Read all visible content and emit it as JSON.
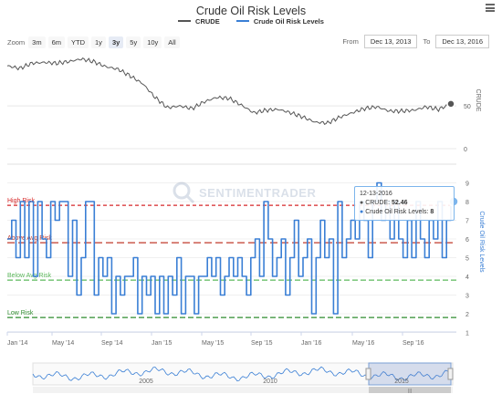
{
  "title": "Crude Oil Risk Levels",
  "legend": [
    {
      "name": "CRUDE",
      "color": "#555555"
    },
    {
      "name": "Crude Oil Risk Levels",
      "color": "#3a7fd5"
    }
  ],
  "zoom": {
    "label": "Zoom",
    "buttons": [
      "3m",
      "6m",
      "YTD",
      "1y",
      "3y",
      "5y",
      "10y",
      "All"
    ],
    "active": "3y"
  },
  "range": {
    "from_label": "From",
    "from": "Dec 13, 2013",
    "to_label": "To",
    "to": "Dec 13, 2016"
  },
  "watermark": "SENTIMENTRADER",
  "tooltip": {
    "date": "12-13-2016",
    "crude_label": "CRUDE:",
    "crude_value": "52.46",
    "risk_label": "Crude Oil Risk Levels:",
    "risk_value": "8"
  },
  "navigator_labels": [
    "2005",
    "2010",
    "2015"
  ],
  "colors": {
    "crude": "#555555",
    "risk": "#3a7fd5",
    "high": "#d62728",
    "above": "#c0392b",
    "below": "#5cb85c",
    "low": "#2e8b2e"
  },
  "chart_data": [
    {
      "type": "line",
      "name": "CRUDE",
      "ylabel": "CRUDE",
      "y_ticks": [
        0,
        50
      ],
      "ylim": [
        0,
        110
      ],
      "x": [
        "2013-12",
        "2014-01",
        "2014-02",
        "2014-03",
        "2014-04",
        "2014-05",
        "2014-06",
        "2014-07",
        "2014-08",
        "2014-09",
        "2014-10",
        "2014-11",
        "2014-12",
        "2015-01",
        "2015-02",
        "2015-03",
        "2015-04",
        "2015-05",
        "2015-06",
        "2015-07",
        "2015-08",
        "2015-09",
        "2015-10",
        "2015-11",
        "2015-12",
        "2016-01",
        "2016-02",
        "2016-03",
        "2016-04",
        "2016-05",
        "2016-06",
        "2016-07",
        "2016-08",
        "2016-09",
        "2016-10",
        "2016-11",
        "2016-12"
      ],
      "values": [
        97,
        94,
        100,
        101,
        100,
        102,
        105,
        102,
        96,
        93,
        85,
        76,
        60,
        48,
        50,
        47,
        55,
        60,
        59,
        51,
        42,
        45,
        46,
        42,
        37,
        31,
        30,
        37,
        42,
        47,
        49,
        44,
        44,
        45,
        49,
        46,
        52.46
      ]
    },
    {
      "type": "line",
      "name": "Crude Oil Risk Levels",
      "ylabel": "Crude Oil Risk Levels",
      "y_ticks": [
        1,
        2,
        3,
        4,
        5,
        6,
        7,
        8,
        9
      ],
      "ylim": [
        1,
        9.5
      ],
      "x_ticks": [
        "Jan '14",
        "May '14",
        "Sep '14",
        "Jan '15",
        "May '15",
        "Sep '15",
        "Jan '16",
        "May '16",
        "Sep '16"
      ],
      "reference_lines": [
        {
          "label": "High Risk",
          "value": 7.8
        },
        {
          "label": "Above Avg Risk",
          "value": 5.8
        },
        {
          "label": "Below Avg Risk",
          "value": 3.8
        },
        {
          "label": "Low Risk",
          "value": 1.8
        }
      ],
      "values": [
        6,
        7,
        5,
        8,
        5,
        8,
        4,
        8,
        6,
        5,
        8,
        7,
        8,
        8,
        4,
        7,
        3,
        5,
        8,
        8,
        3,
        5,
        4,
        5,
        2,
        4,
        3,
        4,
        4,
        5,
        2,
        4,
        3,
        4,
        2,
        4,
        2,
        4,
        3,
        5,
        2,
        4,
        4,
        2,
        4,
        4,
        5,
        4,
        5,
        3,
        4,
        5,
        4,
        5,
        4,
        3,
        5,
        6,
        4,
        8,
        6,
        4,
        5,
        6,
        3,
        5,
        7,
        4,
        5,
        6,
        2,
        5,
        7,
        5,
        6,
        2,
        8,
        5,
        6,
        7,
        6,
        8,
        7,
        5,
        8,
        9,
        7,
        8,
        6,
        8,
        6,
        5,
        7,
        5,
        8,
        6,
        5,
        7,
        6,
        8,
        5,
        7,
        8
      ]
    }
  ]
}
